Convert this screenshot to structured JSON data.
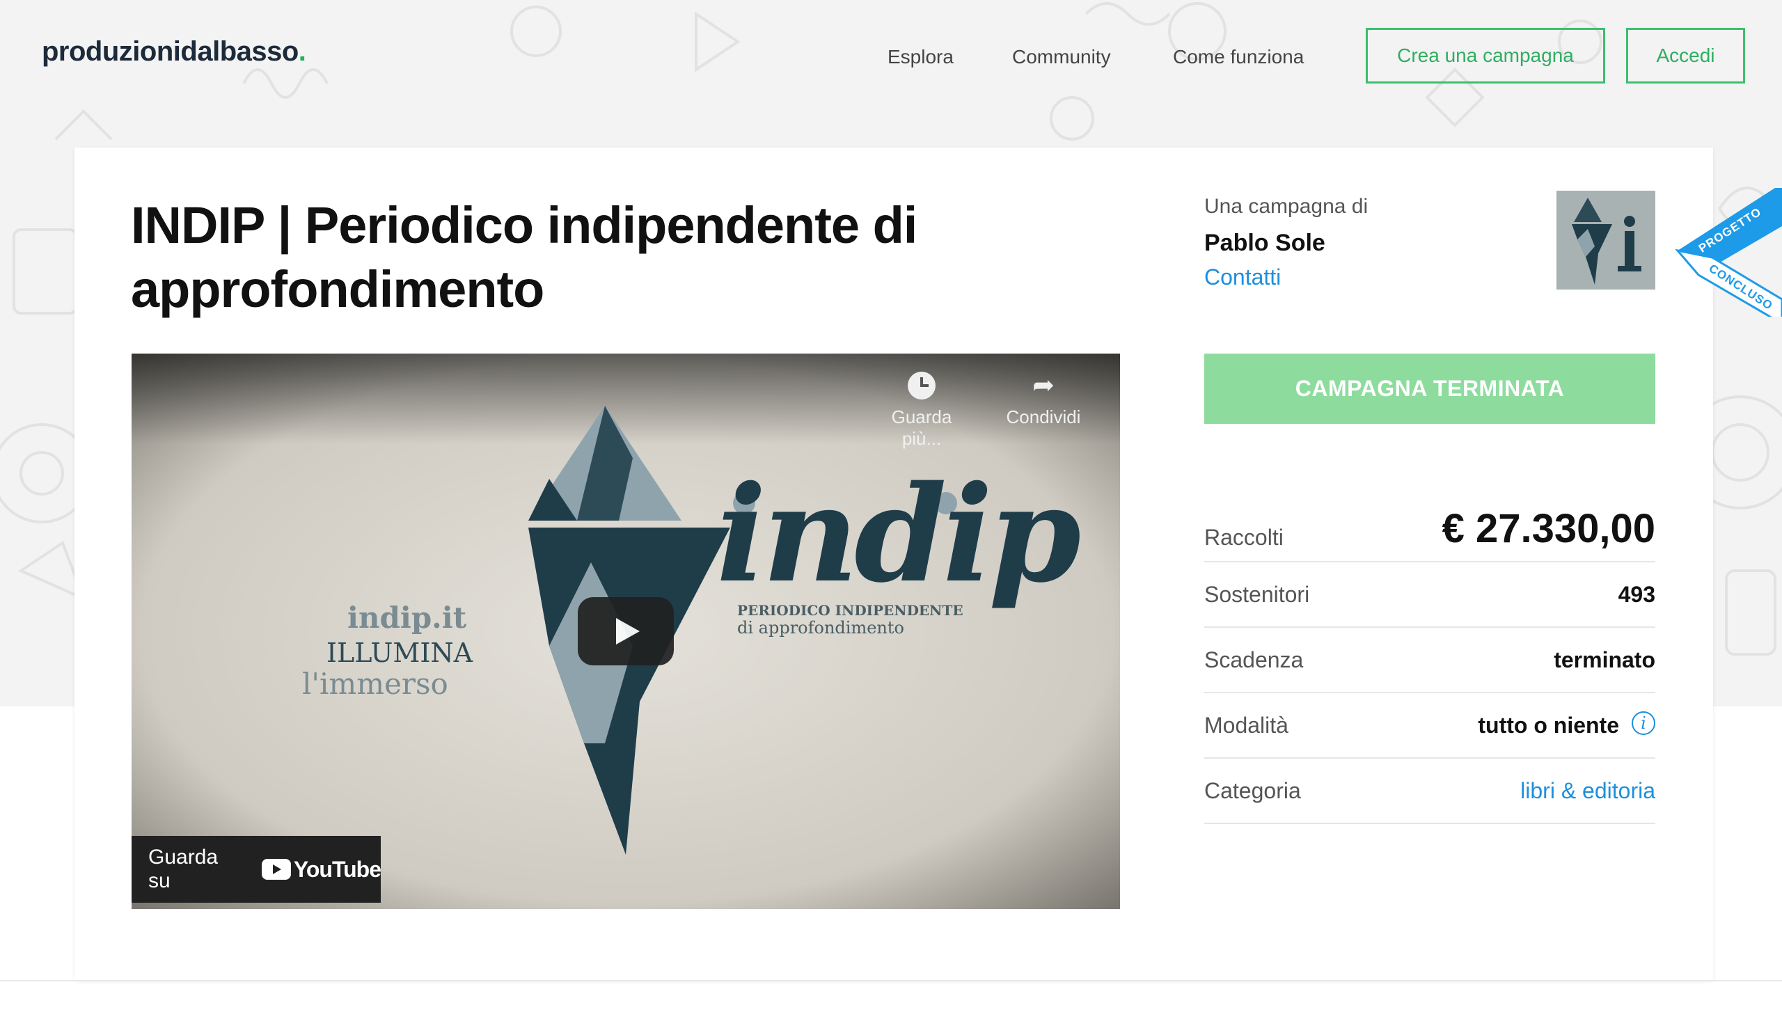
{
  "brand": {
    "name": "produzionidalbasso",
    "dot": ".",
    "accent": "#19b35a"
  },
  "nav": {
    "explore": "Esplora",
    "community": "Community",
    "how": "Come funziona",
    "create": "Crea una campagna",
    "login": "Accedi"
  },
  "campaign": {
    "title": "INDIP | Periodico indipendente di approfondimento",
    "by_label": "Una campagna di",
    "author": "Pablo Sole",
    "contact": "Contatti",
    "status_button": "CAMPAGNA TERMINATA",
    "ribbon_top": "PROGETTO",
    "ribbon_bottom": "CONCLUSO"
  },
  "video": {
    "watch_later": "Guarda più...",
    "share": "Condividi",
    "watch_on": "Guarda su",
    "youtube": "YouTube",
    "overlay": {
      "site": "indip.it",
      "line1": "ILLUMINA",
      "line2": "l'immerso",
      "brand": "indip",
      "sub1": "PERIODICO INDIPENDENTE",
      "sub2": "di approfondimento"
    }
  },
  "stats": {
    "raised_label": "Raccolti",
    "raised_value": "€ 27.330,00",
    "backers_label": "Sostenitori",
    "backers_value": "493",
    "deadline_label": "Scadenza",
    "deadline_value": "terminato",
    "mode_label": "Modalità",
    "mode_value": "tutto o niente",
    "category_label": "Categoria",
    "category_value": "libri & editoria"
  },
  "colors": {
    "green": "#3cbf6e",
    "ended": "#8ddc9e",
    "link": "#1e8fdc",
    "ribbon": "#1e9be8"
  }
}
